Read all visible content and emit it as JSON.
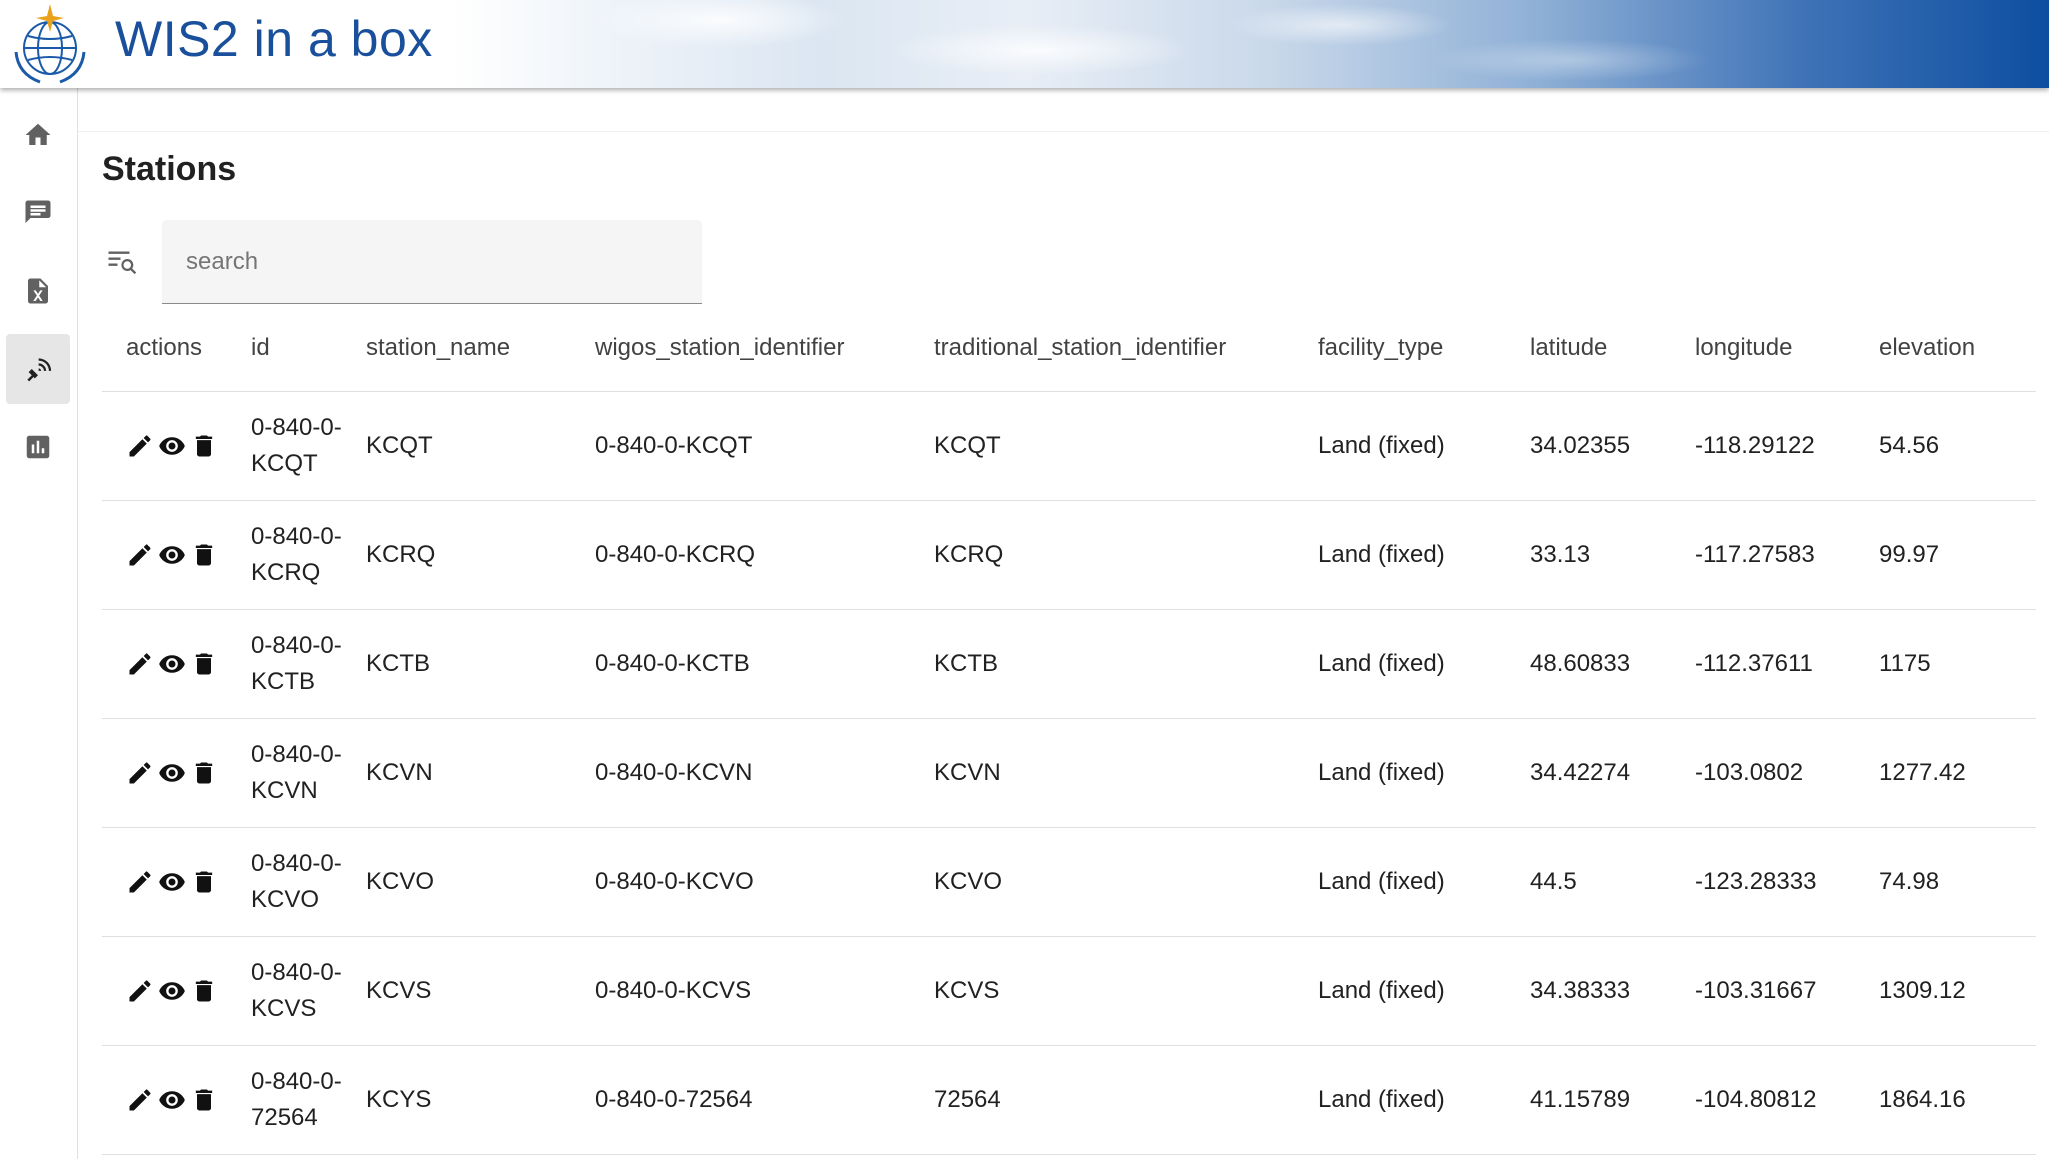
{
  "app": {
    "title": "WIS2 in a box"
  },
  "sidebar": {
    "items": [
      {
        "icon": "home-icon"
      },
      {
        "icon": "notification-icon"
      },
      {
        "icon": "excel-file-icon"
      },
      {
        "icon": "station-antenna-icon",
        "active": true
      },
      {
        "icon": "bar-chart-icon"
      }
    ]
  },
  "page": {
    "title": "Stations"
  },
  "search": {
    "placeholder": "search",
    "value": ""
  },
  "table": {
    "headers": [
      "actions",
      "id",
      "station_name",
      "wigos_station_identifier",
      "traditional_station_identifier",
      "facility_type",
      "latitude",
      "longitude",
      "elevation"
    ],
    "rows": [
      {
        "id": "0-840-0-KCQT",
        "station_name": "KCQT",
        "wigos_station_identifier": "0-840-0-KCQT",
        "traditional_station_identifier": "KCQT",
        "facility_type": "Land (fixed)",
        "latitude": "34.02355",
        "longitude": "-118.29122",
        "elevation": "54.56"
      },
      {
        "id": "0-840-0-KCRQ",
        "station_name": "KCRQ",
        "wigos_station_identifier": "0-840-0-KCRQ",
        "traditional_station_identifier": "KCRQ",
        "facility_type": "Land (fixed)",
        "latitude": "33.13",
        "longitude": "-117.27583",
        "elevation": "99.97"
      },
      {
        "id": "0-840-0-KCTB",
        "station_name": "KCTB",
        "wigos_station_identifier": "0-840-0-KCTB",
        "traditional_station_identifier": "KCTB",
        "facility_type": "Land (fixed)",
        "latitude": "48.60833",
        "longitude": "-112.37611",
        "elevation": "1175"
      },
      {
        "id": "0-840-0-KCVN",
        "station_name": "KCVN",
        "wigos_station_identifier": "0-840-0-KCVN",
        "traditional_station_identifier": "KCVN",
        "facility_type": "Land (fixed)",
        "latitude": "34.42274",
        "longitude": "-103.0802",
        "elevation": "1277.42"
      },
      {
        "id": "0-840-0-KCVO",
        "station_name": "KCVO",
        "wigos_station_identifier": "0-840-0-KCVO",
        "traditional_station_identifier": "KCVO",
        "facility_type": "Land (fixed)",
        "latitude": "44.5",
        "longitude": "-123.28333",
        "elevation": "74.98"
      },
      {
        "id": "0-840-0-KCVS",
        "station_name": "KCVS",
        "wigos_station_identifier": "0-840-0-KCVS",
        "traditional_station_identifier": "KCVS",
        "facility_type": "Land (fixed)",
        "latitude": "34.38333",
        "longitude": "-103.31667",
        "elevation": "1309.12"
      },
      {
        "id": "0-840-0-72564",
        "station_name": "KCYS",
        "wigos_station_identifier": "0-840-0-72564",
        "traditional_station_identifier": "72564",
        "facility_type": "Land (fixed)",
        "latitude": "41.15789",
        "longitude": "-104.80812",
        "elevation": "1864.16"
      }
    ],
    "row_actions": [
      "pencil-icon",
      "eye-icon",
      "trash-icon"
    ]
  },
  "colors": {
    "title_blue": "#1a4f9c",
    "header_dark_blue": "#0d4ea0"
  }
}
